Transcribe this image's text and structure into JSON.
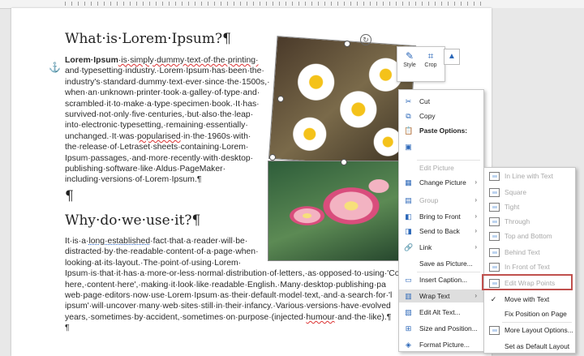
{
  "document": {
    "heading1": "What·is·Lorem·Ipsum?¶",
    "para1_lines": [
      {
        "bold": "Lorem·Ipsum",
        "rest": "·is·simply·dummy·text·of·the·printing·"
      },
      {
        "text": "and·typesetting·industry.·Lorem·Ipsum·has·been·the·"
      },
      {
        "text": "industry's·standard·dummy·text·ever·since·the·1500s,·"
      },
      {
        "text": "when·an·unknown·printer·took·a·galley·of·type·and·"
      },
      {
        "text": "scrambled·it·to·make·a·type·specimen·book.·It·has·"
      },
      {
        "text": "survived·not·only·five·centuries,·but·also·the·leap·"
      },
      {
        "text": "into·electronic·typesetting,·remaining·essentially·"
      },
      {
        "pre": "unchanged.·It·was·",
        "squig": "popularised",
        "post": "·in·the·1960s·with·"
      },
      {
        "text": "the·release·of·Letraset·sheets·containing·Lorem·"
      },
      {
        "text": "Ipsum·passages,·and·more·recently·with·desktop·"
      },
      {
        "text": "publishing·software·like·Aldus·PageMaker·"
      },
      {
        "text": "including·versions·of·Lorem·Ipsum.¶"
      }
    ],
    "empty_pilcrow": "¶",
    "heading2": "Why·do·we·use·it?¶",
    "para2_lines": [
      {
        "pre": "It·is·a·",
        "dot": "long·established",
        "post": "·fact·that·a·reader·will·be·"
      },
      {
        "text": "distracted·by·the·readable·content·of·a·page·when·"
      },
      {
        "text": "looking·at·its·layout.·The·point·of·using·Lorem·"
      },
      {
        "text": "Ipsum·is·that·it·has·a·more-or-less·normal·distribution·of·letters,·as·opposed·to·using·'Co"
      },
      {
        "text": "here,·content·here',·making·it·look·like·readable·English.·Many·desktop·publishing·pa"
      },
      {
        "text": "web·page·editors·now·use·Lorem·Ipsum·as·their·default·model·text,·and·a·search·for·'l"
      },
      {
        "text": "ipsum'·will·uncover·many·web·sites·still·in·their·infancy.·Various·versions·have·evolved"
      },
      {
        "pre": "years,·sometimes·by·accident,·sometimes·on·purpose·(injected·",
        "squig": "humour",
        "post": "·and·the·like).¶"
      },
      {
        "text": "¶"
      }
    ]
  },
  "mini_toolbar": {
    "style_label": "Style",
    "crop_label": "Crop"
  },
  "context_menu": {
    "items": [
      {
        "label": "Cut",
        "icon": "scissors-icon",
        "glyph": "✂",
        "enabled": true
      },
      {
        "label": "Copy",
        "icon": "copy-icon",
        "glyph": "⧉",
        "enabled": true
      },
      {
        "label": "Paste Options:",
        "icon": "paste-icon",
        "glyph": "📋",
        "enabled": true,
        "bold": true
      },
      {
        "label": "",
        "icon": "paste-picture-icon",
        "glyph": "▣",
        "enabled": true
      },
      {
        "label": "Edit Picture",
        "icon": "",
        "glyph": "",
        "enabled": false
      },
      {
        "label": "Change Picture",
        "icon": "change-picture-icon",
        "glyph": "▦",
        "enabled": true,
        "submenu": true
      },
      {
        "label": "Group",
        "icon": "group-icon",
        "glyph": "▤",
        "enabled": false,
        "submenu": true
      },
      {
        "label": "Bring to Front",
        "icon": "bring-to-front-icon",
        "glyph": "◧",
        "enabled": true,
        "submenu": true
      },
      {
        "label": "Send to Back",
        "icon": "send-to-back-icon",
        "glyph": "◨",
        "enabled": true,
        "submenu": true
      },
      {
        "label": "Link",
        "icon": "link-icon",
        "glyph": "🔗",
        "enabled": true,
        "submenu": true
      },
      {
        "label": "Save as Picture...",
        "icon": "",
        "glyph": "",
        "enabled": true
      },
      {
        "label": "Insert Caption...",
        "icon": "caption-icon",
        "glyph": "▭",
        "enabled": true
      },
      {
        "label": "Wrap Text",
        "icon": "wrap-text-icon",
        "glyph": "▥",
        "enabled": true,
        "submenu": true,
        "highlighted": true
      },
      {
        "label": "Edit Alt Text...",
        "icon": "alt-text-icon",
        "glyph": "▧",
        "enabled": true
      },
      {
        "label": "Size and Position...",
        "icon": "size-position-icon",
        "glyph": "⊞",
        "enabled": true
      },
      {
        "label": "Format Picture...",
        "icon": "format-picture-icon",
        "glyph": "◈",
        "enabled": true
      }
    ]
  },
  "wrap_submenu": {
    "items": [
      {
        "label": "In Line with Text",
        "enabled": false,
        "icon": "in-line-icon"
      },
      {
        "label": "Square",
        "enabled": false,
        "icon": "square-wrap-icon"
      },
      {
        "label": "Tight",
        "enabled": false,
        "icon": "tight-wrap-icon"
      },
      {
        "label": "Through",
        "enabled": false,
        "icon": "through-wrap-icon"
      },
      {
        "label": "Top and Bottom",
        "enabled": false,
        "icon": "top-bottom-wrap-icon"
      },
      {
        "label": "Behind Text",
        "enabled": false,
        "icon": "behind-text-icon"
      },
      {
        "label": "In Front of Text",
        "enabled": false,
        "icon": "in-front-text-icon"
      },
      {
        "label": "Edit Wrap Points",
        "enabled": false,
        "icon": "edit-wrap-points-icon",
        "boxed": true
      },
      {
        "label": "Move with Text",
        "enabled": true,
        "icon": "check-icon",
        "checked": true
      },
      {
        "label": "Fix Position on Page",
        "enabled": true,
        "icon": ""
      },
      {
        "label": "More Layout Options...",
        "enabled": true,
        "icon": "layout-options-icon"
      },
      {
        "label": "Set as Default Layout",
        "enabled": true,
        "icon": ""
      }
    ]
  },
  "colors": {
    "accent": "#2b67b8",
    "highlight_box": "#c0504d",
    "menu_hover": "#dedede"
  }
}
